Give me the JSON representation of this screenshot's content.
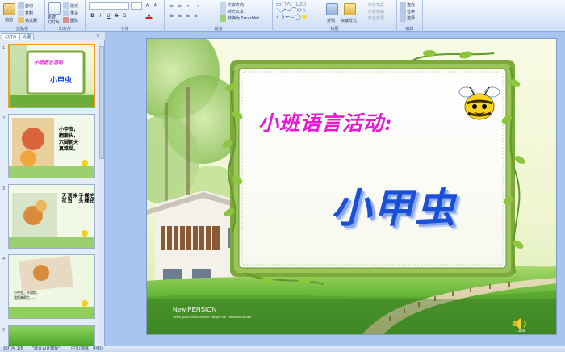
{
  "ribbon": {
    "clipboard": {
      "label": "剪贴板",
      "paste": "粘贴",
      "cut": "剪切",
      "copy": "复制",
      "format_painter": "格式刷"
    },
    "slides": {
      "label": "幻灯片",
      "new_slide": "新建\n幻灯片",
      "layout": "版式",
      "reset": "重设",
      "delete": "删除"
    },
    "font": {
      "label": "字体",
      "font_name": "",
      "font_size": ""
    },
    "paragraph": {
      "label": "段落",
      "text_direction": "文字方向",
      "align_text": "对齐文本",
      "convert_smartart": "转换为 SmartArt"
    },
    "drawing": {
      "label": "绘图",
      "arrange": "排列",
      "quick_styles": "快速样式",
      "shape_fill": "形状填充",
      "shape_outline": "形状轮廓",
      "shape_effects": "形状效果"
    },
    "editing": {
      "label": "编辑",
      "find": "查找",
      "replace": "替换",
      "select": "选择"
    }
  },
  "pane": {
    "tab_slides": "幻灯片",
    "tab_outline": "大纲",
    "close": "×",
    "thumbnails": [
      {
        "num": "1",
        "title": "小班语言活动",
        "subtitle": "小甲虫"
      },
      {
        "num": "2",
        "text": "小甲虫，\n翻跟头，\n六脚朝天\n真难受。"
      },
      {
        "num": "3",
        "text": "它把\n蝴蝶\n子头\n来\n顶当\n天花"
      },
      {
        "num": "4",
        "text": "小甲虫，不用慌，\n我们来帮忙……"
      },
      {
        "num": "5",
        "text": ""
      }
    ]
  },
  "slide": {
    "activity_title": "小班语言活动:",
    "main_title": "小甲虫",
    "caption": "New PENSION",
    "caption_sub": "lorem ipsum environment · simple life · beautiful house",
    "logo_text": "Lura"
  },
  "status": {
    "slide_count": "幻灯片 1/6",
    "theme": "\"默认设计模板\"",
    "language": "中文(简体，中国)"
  },
  "colors": {
    "activity_title": "#e619d5",
    "main_title": "#1a4fd8",
    "frame_green": "#7fa83a",
    "ribbon_bg": "#dde8f7",
    "workspace_bg": "#a7c5ee"
  }
}
